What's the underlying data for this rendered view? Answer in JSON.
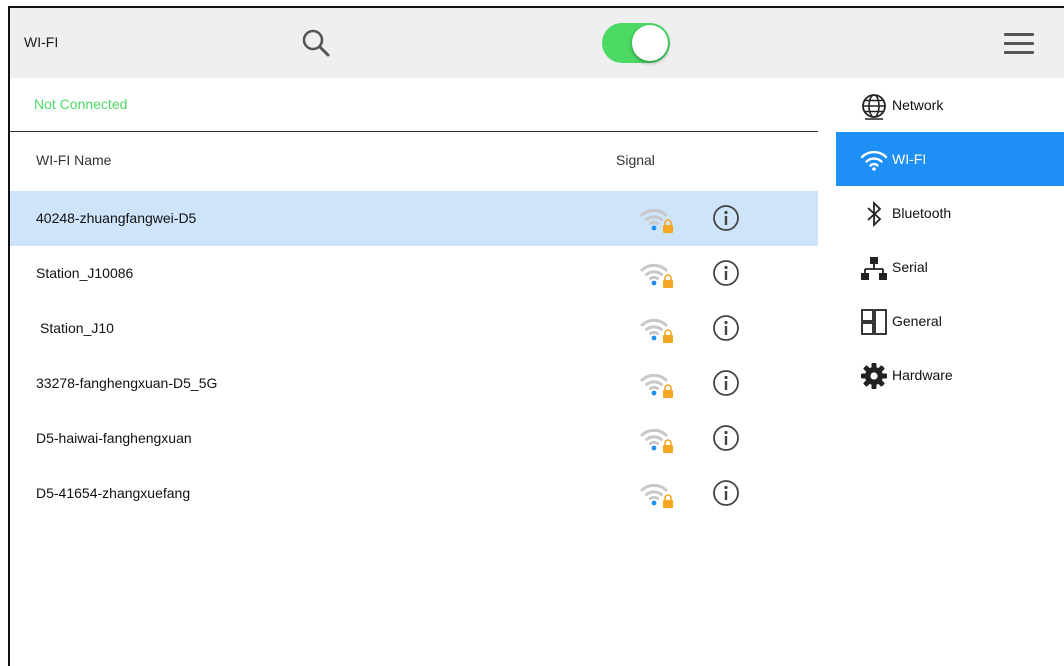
{
  "header": {
    "title": "WI-FI",
    "search_icon": "search-icon",
    "toggle_on": true,
    "toggle_color": "#4cd964",
    "menu_icon": "hamburger-menu-icon"
  },
  "status": {
    "text": "Not Connected",
    "color": "#4cd964"
  },
  "table": {
    "columns": [
      "WI-FI Name",
      "Signal"
    ],
    "rows": [
      {
        "name": "40248-zhuangfangwei-D5",
        "selected": true
      },
      {
        "name": "Station_J10086"
      },
      {
        "name": "Station_J10"
      },
      {
        "name": "33278-fanghengxuan-D5_5G"
      },
      {
        "name": "D5-haiwai-fanghengxuan"
      },
      {
        "name": "D5-41654-zhangxuefang"
      }
    ],
    "selected_color": "#cde4fb",
    "signal_icon": "wifi-locked-icon",
    "info_icon": "info-icon"
  },
  "sidebar": {
    "active_color": "#1e90f5",
    "items": [
      {
        "label": "Network",
        "icon": "globe-icon"
      },
      {
        "label": "WI-FI",
        "icon": "wifi-icon",
        "active": true
      },
      {
        "label": "Bluetooth",
        "icon": "bluetooth-icon"
      },
      {
        "label": "Serial",
        "icon": "serial-network-icon"
      },
      {
        "label": "General",
        "icon": "grid-panels-icon"
      },
      {
        "label": "Hardware",
        "icon": "gear-icon"
      }
    ]
  }
}
